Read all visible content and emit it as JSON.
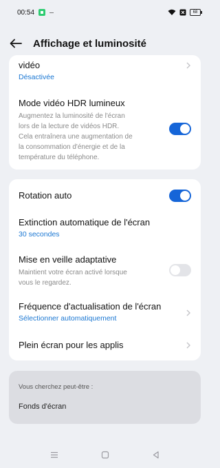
{
  "status_bar": {
    "time": "00:54",
    "battery": "68"
  },
  "header": {
    "title": "Affichage et luminosité"
  },
  "card1": {
    "video_row": {
      "title": "vidéo",
      "value": "Désactivée"
    },
    "hdr_row": {
      "title": "Mode vidéo HDR lumineux",
      "desc_lines": [
        "Augmentez la luminosité de l'écran",
        "lors de la lecture de vidéos HDR.",
        "Cela entraînera une augmentation de",
        "la consommation d'énergie et de la",
        "température du téléphone."
      ],
      "toggle_on": true
    }
  },
  "card2": {
    "rotation": {
      "title": "Rotation auto",
      "toggle_on": true
    },
    "screen_timeout": {
      "title": "Extinction automatique de l'écran",
      "value": "30 secondes"
    },
    "adaptive_sleep": {
      "title": "Mise en veille adaptative",
      "desc_lines": [
        "Maintient votre écran activé lorsque",
        "vous le regardez."
      ],
      "toggle_on": false
    },
    "refresh_rate": {
      "title": "Fréquence d'actualisation de l'écran",
      "value": "Sélectionner automatiquement"
    },
    "fullscreen_apps": {
      "title": "Plein écran pour les applis"
    }
  },
  "suggestions": {
    "label": "Vous cherchez peut-être :",
    "item": "Fonds d'écran"
  },
  "colors": {
    "accent": "#1565d8",
    "link": "#1976d2",
    "background": "#eef0f4"
  }
}
